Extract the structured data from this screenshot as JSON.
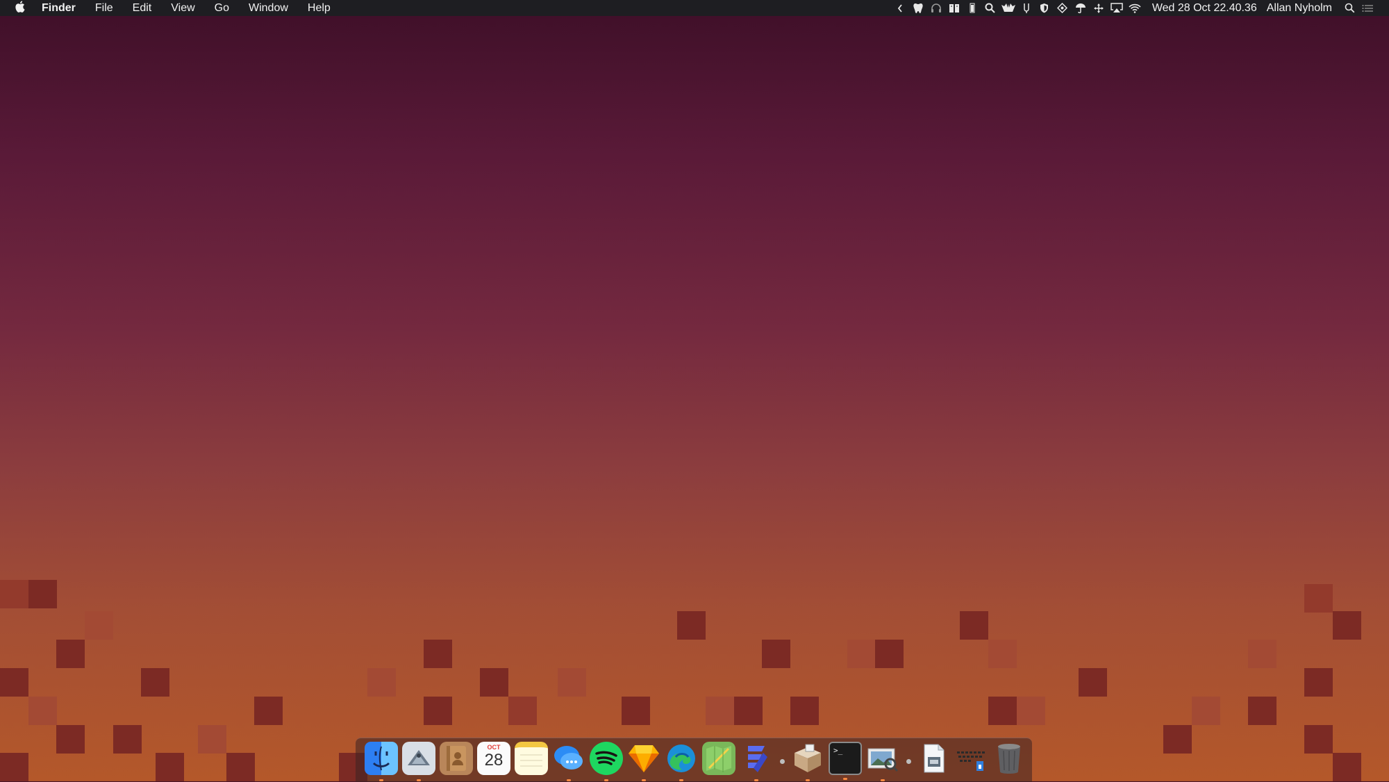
{
  "menubar": {
    "apple_icon": "apple-logo-icon",
    "app_name": "Finder",
    "menus": [
      "File",
      "Edit",
      "View",
      "Go",
      "Window",
      "Help"
    ],
    "status_icons": [
      "chevron-left-icon",
      "tooth-icon",
      "headphones-icon",
      "book-icon",
      "battery-icon",
      "search-bolt-icon",
      "hands-icon",
      "usb-icon",
      "shield-icon",
      "diamond-icon",
      "umbrella-icon",
      "move-arrows-icon",
      "airplay-icon",
      "wifi-icon"
    ],
    "clock": "Wed 28 Oct  22.40.36",
    "user": "Allan Nyholm",
    "spotlight_icon": "magnifier-icon",
    "notification_icon": "list-icon"
  },
  "dock": {
    "apps": [
      {
        "name": "finder",
        "icon": "finder-icon",
        "running": true
      },
      {
        "name": "mail-eagle",
        "icon": "eagle-mail-icon",
        "running": true
      },
      {
        "name": "contacts",
        "icon": "contacts-book-icon",
        "running": false
      },
      {
        "name": "calendar",
        "icon": "calendar-icon",
        "running": false,
        "month": "OCT",
        "day": "28"
      },
      {
        "name": "notes",
        "icon": "notes-icon",
        "running": false
      },
      {
        "name": "messages",
        "icon": "chat-bubbles-icon",
        "running": true
      },
      {
        "name": "spotify",
        "icon": "spotify-icon",
        "running": true
      },
      {
        "name": "sketch",
        "icon": "sketch-diamond-icon",
        "running": true
      },
      {
        "name": "edge",
        "icon": "edge-browser-icon",
        "running": true
      },
      {
        "name": "maps",
        "icon": "maps-icon",
        "running": false
      },
      {
        "name": "textsoap",
        "icon": "text-lines-icon",
        "running": true
      }
    ],
    "apps_after_sep": [
      {
        "name": "archive-utility",
        "icon": "package-icon",
        "running": true
      },
      {
        "name": "terminal",
        "icon": "terminal-icon",
        "running": true,
        "prompt": ">_"
      },
      {
        "name": "preview",
        "icon": "preview-photos-icon",
        "running": true
      }
    ],
    "stacks": [
      {
        "name": "document",
        "icon": "document-icon"
      },
      {
        "name": "keyboard-viewer",
        "icon": "keyboard-icon"
      },
      {
        "name": "trash",
        "icon": "trash-icon"
      }
    ]
  }
}
